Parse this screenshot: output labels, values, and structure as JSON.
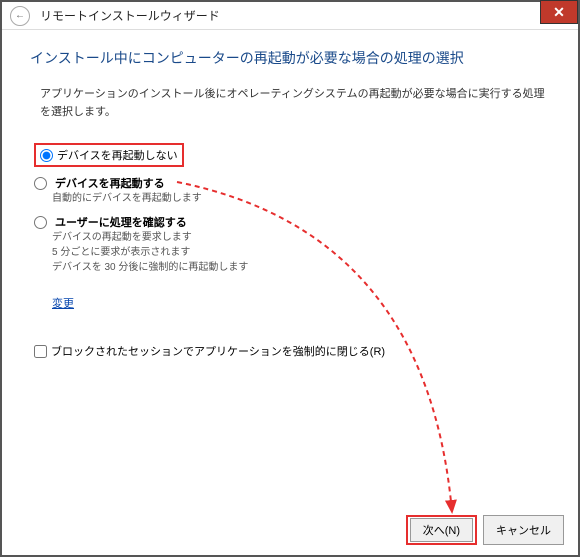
{
  "titlebar": {
    "title": "リモートインストールウィザード",
    "close": "✕",
    "back": "←"
  },
  "heading": "インストール中にコンピューターの再起動が必要な場合の処理の選択",
  "description": "アプリケーションのインストール後にオペレーティングシステムの再起動が必要な場合に実行する処理を選択します。",
  "options": {
    "opt1": {
      "label": "デバイスを再起動しない"
    },
    "opt2": {
      "label": "デバイスを再起動する",
      "sub": "自動的にデバイスを再起動します"
    },
    "opt3": {
      "label": "ユーザーに処理を確認する",
      "sub1": "デバイスの再起動を要求します",
      "sub2": "5 分ごとに要求が表示されます",
      "sub3": "デバイスを 30 分後に強制的に再起動します"
    }
  },
  "change_link": "変更",
  "checkbox_label": "ブロックされたセッションでアプリケーションを強制的に閉じる(R)",
  "footer": {
    "next": "次へ(N)",
    "cancel": "キャンセル"
  }
}
